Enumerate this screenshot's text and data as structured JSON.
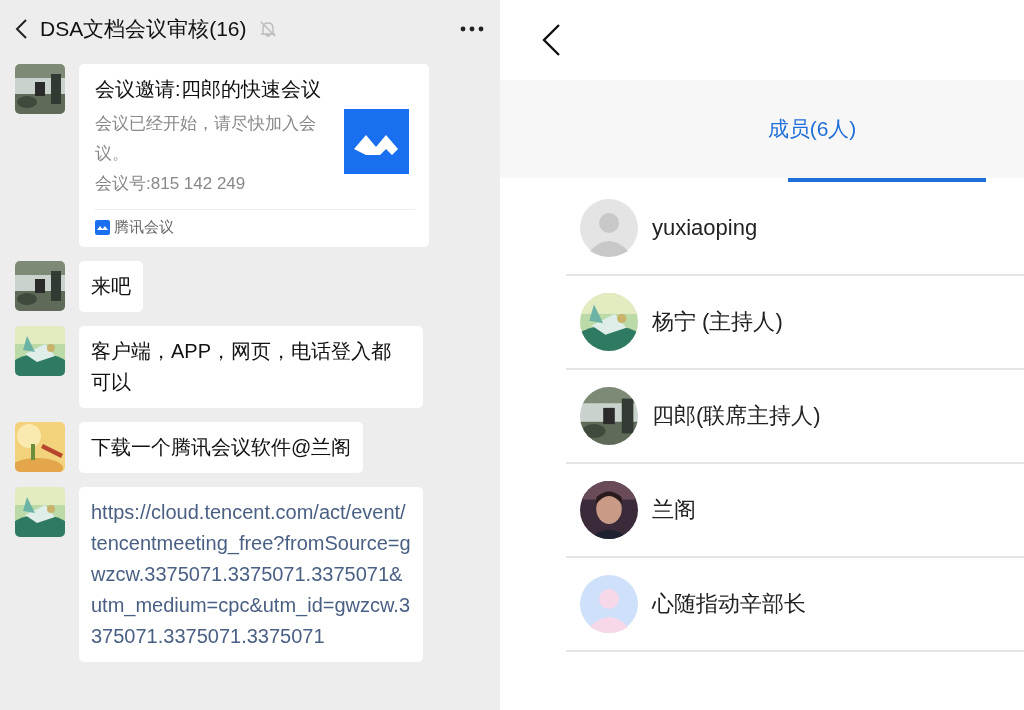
{
  "chat": {
    "title": "DSA文档会议审核(16)",
    "muted": true,
    "messages": [
      {
        "kind": "card",
        "title": "会议邀请:四郎的快速会议",
        "body": "会议已经开始，请尽快加入会议。",
        "meeting_number": "会议号:815 142 249",
        "source": "腾讯会议"
      },
      {
        "kind": "text",
        "text": "来吧"
      },
      {
        "kind": "text",
        "text": "客户端，APP，网页，电话登入都可以"
      },
      {
        "kind": "text",
        "text": "下载一个腾讯会议软件@兰阁"
      },
      {
        "kind": "link",
        "text": "https://cloud.tencent.com/act/event/tencentmeeting_free?fromSource=gwzcw.3375071.3375071.3375071&utm_medium=cpc&utm_id=gwzcw.3375071.3375071.3375071"
      }
    ]
  },
  "members_panel": {
    "tabs": [
      {
        "label": "成员(6人)",
        "selected": true
      }
    ],
    "members": [
      {
        "name": "yuxiaoping",
        "kind": "grey"
      },
      {
        "name": "杨宁 (主持人)"
      },
      {
        "name": "四郎(联席主持人)"
      },
      {
        "name": "兰阁"
      },
      {
        "name": "心随指动辛部长",
        "kind": "pastel"
      }
    ]
  }
}
